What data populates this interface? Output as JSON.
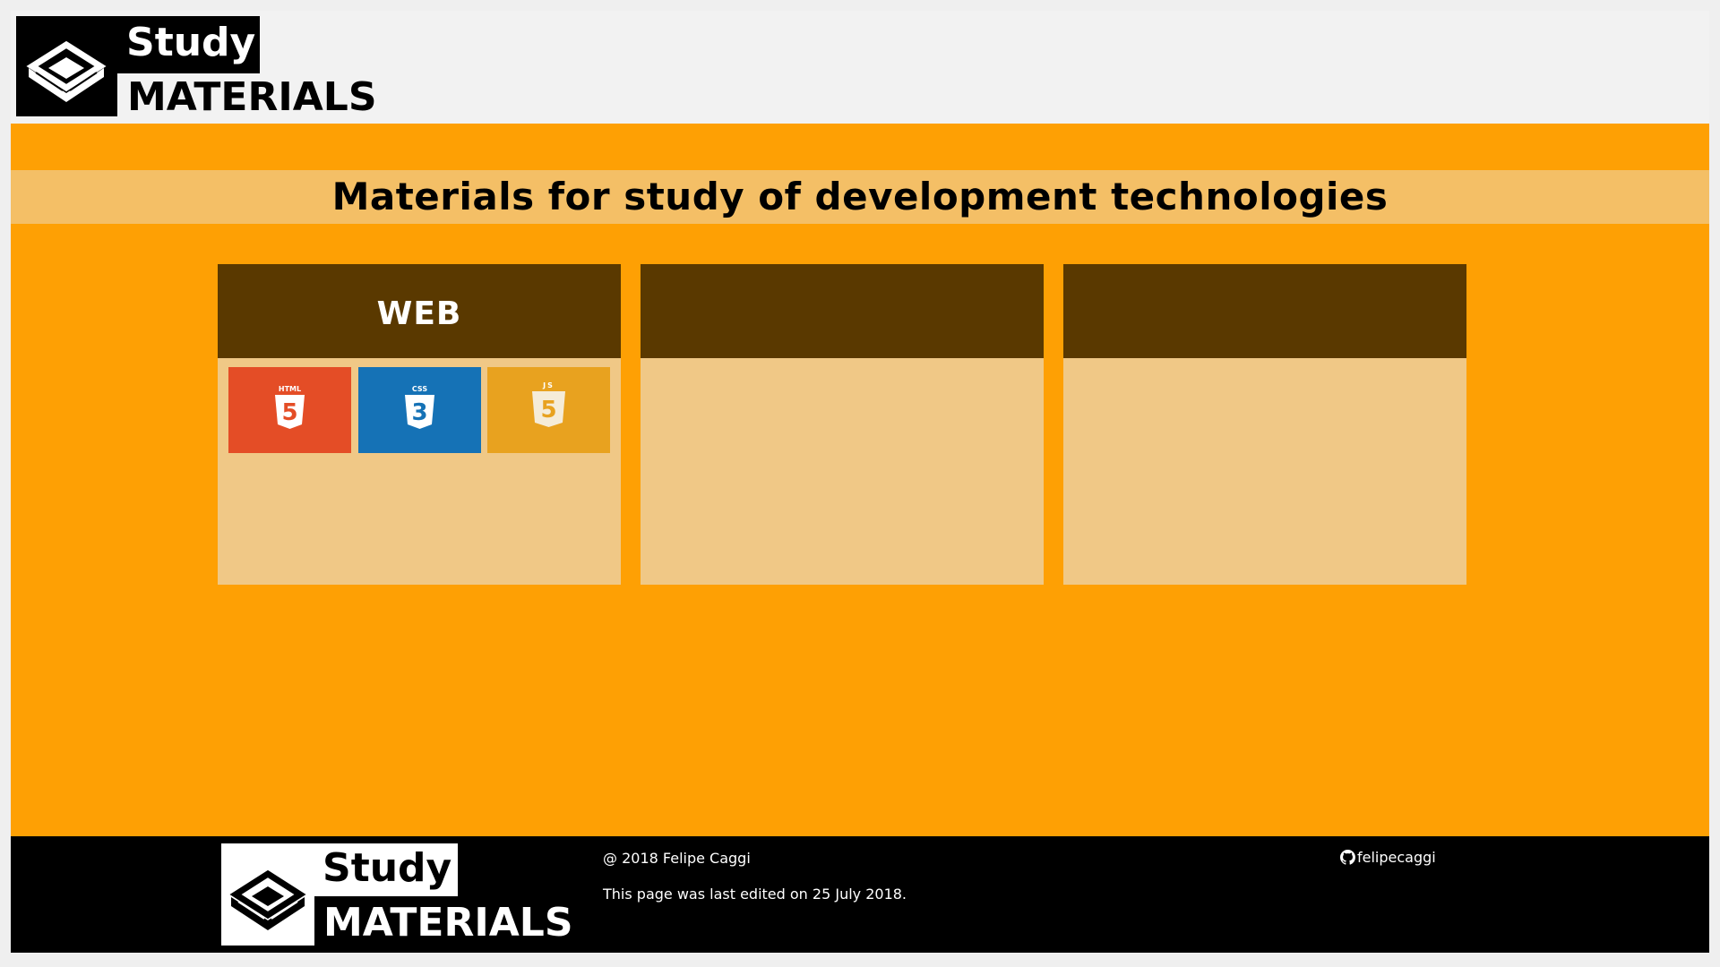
{
  "brand": {
    "word_top": "Study",
    "word_bottom": "MATERIALS",
    "icon": "box-icon"
  },
  "main": {
    "headline": "Materials for study of development technologies",
    "cards": [
      {
        "title": "WEB",
        "tiles": [
          {
            "label": "HTML",
            "numeral": "5",
            "icon": "html5-icon",
            "color": "#e44d26"
          },
          {
            "label": "CSS",
            "numeral": "3",
            "icon": "css3-icon",
            "color": "#1572b6"
          },
          {
            "label": "JS",
            "numeral": "5",
            "icon": "js-icon",
            "color": "#e8a21f"
          }
        ]
      },
      {
        "title": "",
        "tiles": []
      },
      {
        "title": "",
        "tiles": []
      }
    ]
  },
  "footer": {
    "copyright": "@ 2018 Felipe Caggi",
    "last_edited": "This page was last edited on 25 July 2018.",
    "github_user": "felipecaggi",
    "github_icon": "github-icon"
  },
  "colors": {
    "main_background": "#fea004",
    "banner": "#f4bf66",
    "card_header": "#5a3900",
    "card_body": "#f0c886",
    "header_background": "#f2f2f2",
    "footer_background": "#000000"
  }
}
